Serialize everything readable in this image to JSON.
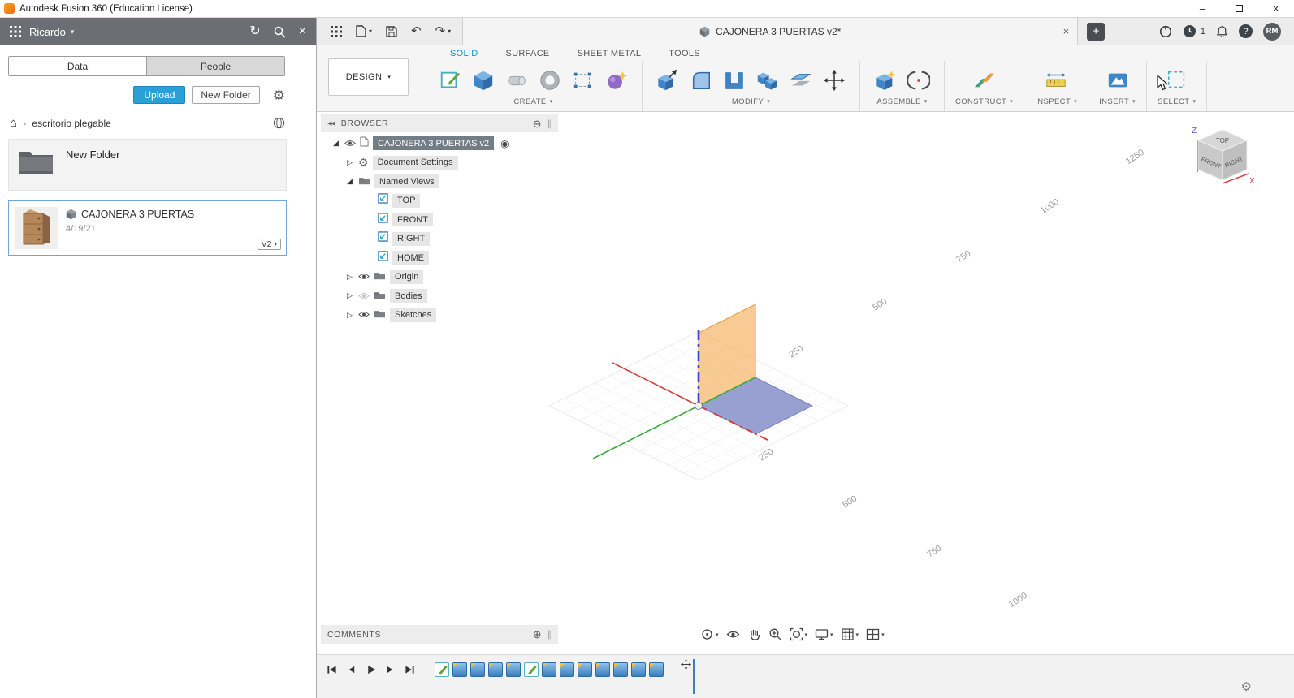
{
  "titlebar": {
    "title": "Autodesk Fusion 360 (Education License)"
  },
  "data_panel": {
    "user": "Ricardo",
    "tab_data": "Data",
    "tab_people": "People",
    "upload": "Upload",
    "new_folder": "New Folder",
    "breadcrumb": "escritorio plegable",
    "folder_item": {
      "title": "New Folder"
    },
    "design_item": {
      "title": "CAJONERA 3 PUERTAS",
      "date": "4/19/21",
      "version": "V2"
    }
  },
  "doc_bar": {
    "tab_title": "CAJONERA 3 PUERTAS v2*",
    "job_count": "1",
    "avatar": "RM"
  },
  "toolbar": {
    "workspace": "DESIGN",
    "tabs": {
      "solid": "SOLID",
      "surface": "SURFACE",
      "sheet_metal": "SHEET METAL",
      "tools": "TOOLS"
    },
    "groups": {
      "create": "CREATE",
      "modify": "MODIFY",
      "assemble": "ASSEMBLE",
      "construct": "CONSTRUCT",
      "inspect": "INSPECT",
      "insert": "INSERT",
      "select": "SELECT"
    }
  },
  "browser": {
    "title": "BROWSER",
    "items": [
      {
        "label": "CAJONERA 3 PUERTAS v2"
      },
      {
        "label": "Document Settings"
      },
      {
        "label": "Named Views"
      },
      {
        "label": "TOP"
      },
      {
        "label": "FRONT"
      },
      {
        "label": "RIGHT"
      },
      {
        "label": "HOME"
      },
      {
        "label": "Origin"
      },
      {
        "label": "Bodies"
      },
      {
        "label": "Sketches"
      }
    ]
  },
  "viewport": {
    "dims_upper": [
      "250",
      "500",
      "750",
      "1000",
      "1250"
    ],
    "dims_lower": [
      "250",
      "500",
      "750",
      "1000"
    ],
    "viewcube": {
      "top": "TOP",
      "front": "FRONT",
      "right": "RIGHT",
      "z": "Z",
      "x": "X"
    }
  },
  "comments": {
    "title": "COMMENTS"
  },
  "timeline": {
    "features": [
      "sketch",
      "extrude",
      "extrude",
      "extrude",
      "extrude",
      "sketch",
      "extrude",
      "extrude",
      "extrude",
      "extrude",
      "extrude",
      "extrude",
      "extrude"
    ]
  },
  "icons": {
    "chevron_down": "▾",
    "close": "×",
    "plus": "+",
    "minimize": "–",
    "help": "?",
    "collapse_circle": "⊖",
    "add_circle": "⊕",
    "grip": "∥",
    "gear": "⚙",
    "sync": "↻",
    "undo": "↶",
    "redo": "↷",
    "home": "⌂",
    "crumb_sep": "›",
    "radio": "◉",
    "expander_collapsed": "▷",
    "expander_expanded": "◢",
    "panel_collapse": "◀◀"
  }
}
